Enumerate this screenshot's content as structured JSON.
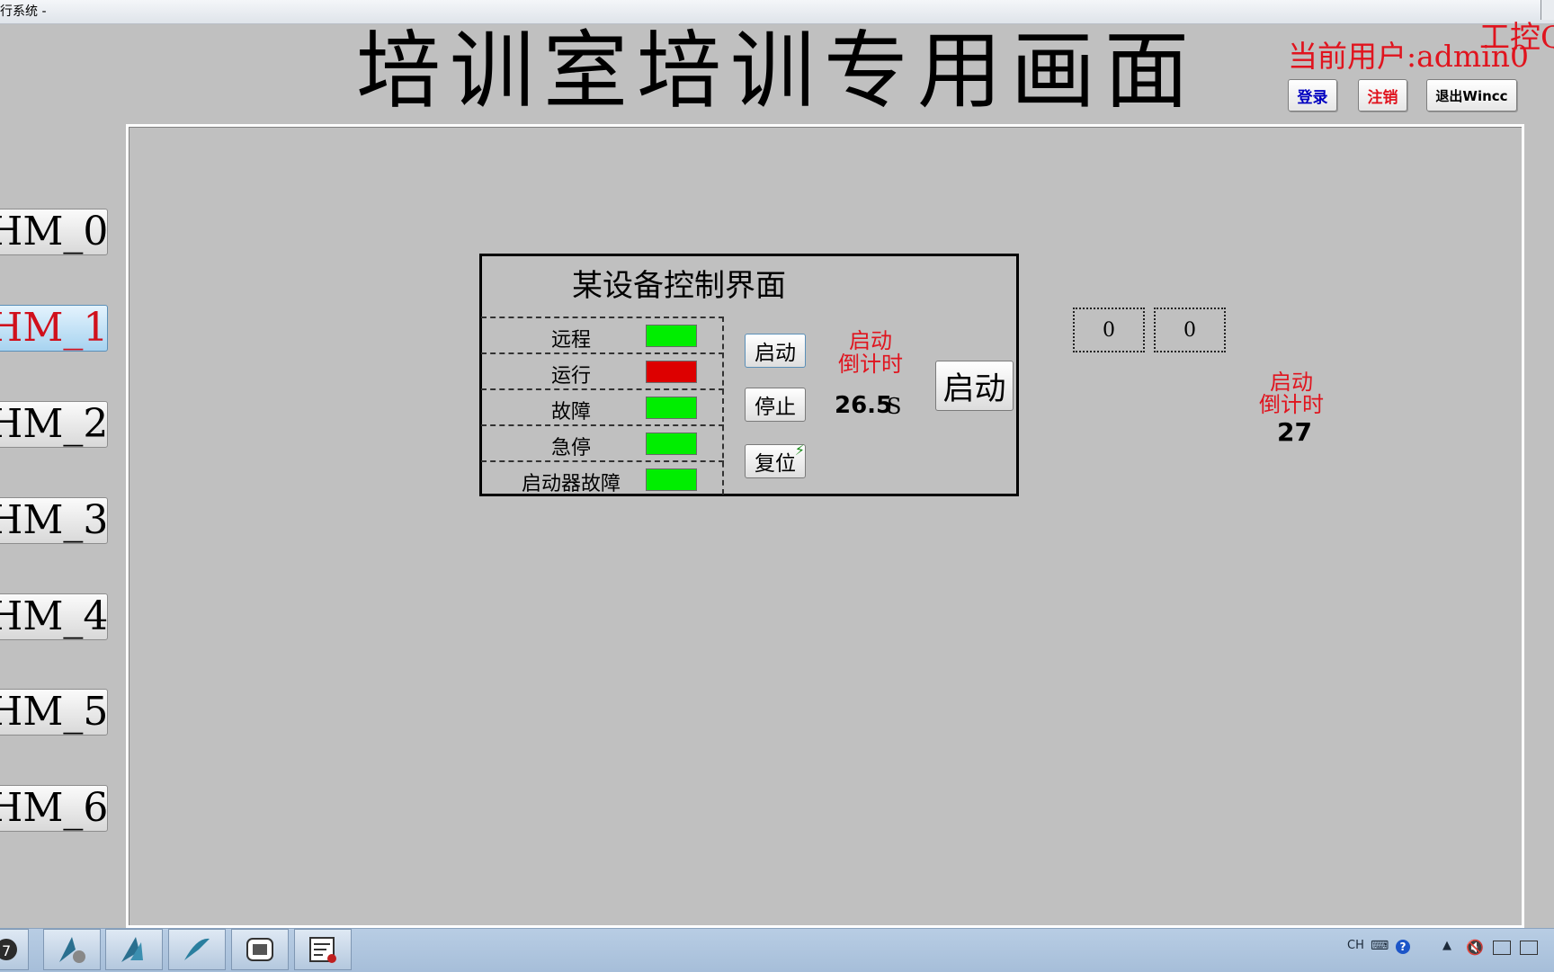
{
  "window": {
    "title": "运行系统 -"
  },
  "header": {
    "title": "培训室培训专用画面",
    "current_user": "当前用户:admin0",
    "corner_mark": "工控Q",
    "login_label": "登录",
    "logout_label": "注销",
    "exit_label": "退出Wincc"
  },
  "nav": {
    "items": [
      {
        "label": "HM_0"
      },
      {
        "label": "HM_1"
      },
      {
        "label": "HM_2"
      },
      {
        "label": "HM_3"
      },
      {
        "label": "HM_4"
      },
      {
        "label": "HM_5"
      },
      {
        "label": "HM_6"
      }
    ],
    "active_index": 1
  },
  "control_panel": {
    "title": "某设备控制界面",
    "status_rows": [
      {
        "label": "远程",
        "lamp_color": "#00ee00"
      },
      {
        "label": "运行",
        "lamp_color": "#dd0000"
      },
      {
        "label": "故障",
        "lamp_color": "#00ee00"
      },
      {
        "label": "急停",
        "lamp_color": "#00ee00"
      },
      {
        "label": "启动器故障",
        "lamp_color": "#00ee00"
      }
    ],
    "start_label": "启动",
    "stop_label": "停止",
    "reset_label": "复位",
    "countdown_label_1": "启动",
    "countdown_label_2": "倒计时",
    "countdown_value": "26.5",
    "countdown_unit": "S",
    "big_start_label": "启动"
  },
  "side": {
    "io_value_1": "0",
    "io_value_2": "0",
    "countdown_label_1": "启动",
    "countdown_label_2": "倒计时",
    "countdown_value": "27"
  },
  "taskbar": {
    "lang": "CH",
    "icons": [
      "wincc-explorer-icon",
      "graphics-icon",
      "alarm-icon",
      "tag-logging-icon",
      "simulator-icon",
      "project-icon"
    ]
  },
  "colors": {
    "accent_red": "#e0141e",
    "lamp_green": "#00ee00",
    "lamp_red": "#dd0000",
    "background": "#c0c0c0"
  }
}
